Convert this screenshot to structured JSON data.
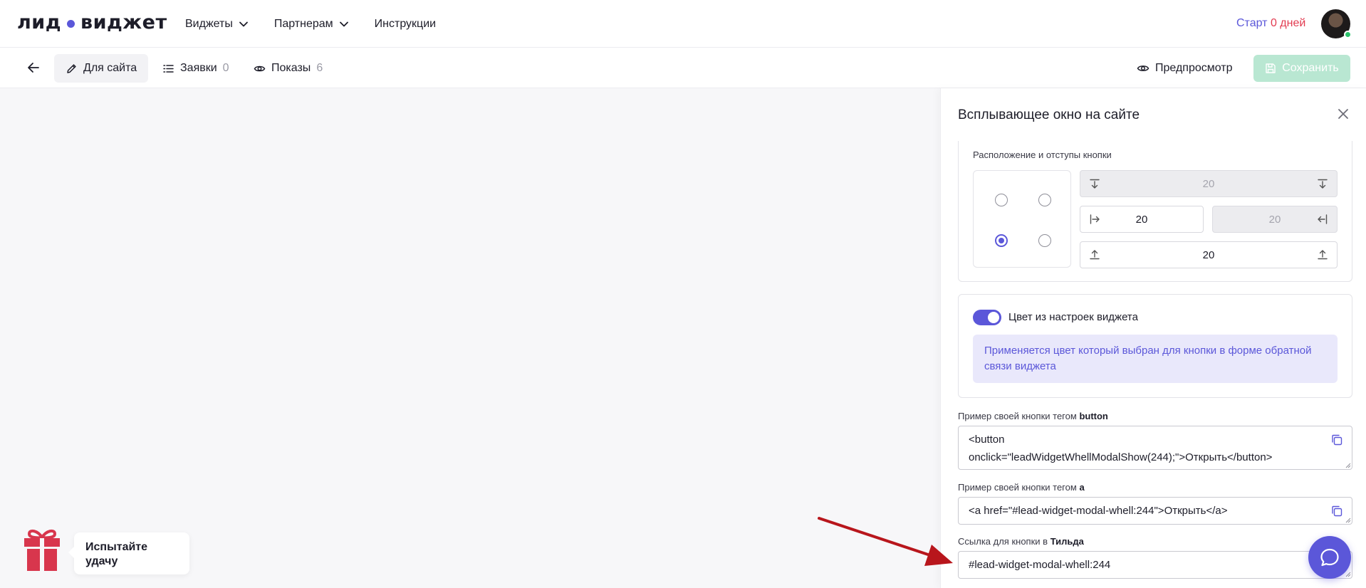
{
  "brand": {
    "logo_left": "лид",
    "logo_right": "виджет"
  },
  "nav": {
    "widgets": "Виджеты",
    "partners": "Партнерам",
    "instructions": "Инструкции"
  },
  "trial": {
    "label": "Старт",
    "days": "0 дней"
  },
  "toolbar": {
    "tab_site": "Для сайта",
    "tab_requests": "Заявки",
    "requests_count": "0",
    "tab_views": "Показы",
    "views_count": "6",
    "preview": "Предпросмотр",
    "save": "Сохранить"
  },
  "panel": {
    "title": "Всплывающее окно на сайте",
    "position_label": "Расположение и отступы кнопки",
    "selected_corner": "bottom-left",
    "offsets": {
      "top": "20",
      "left": "20",
      "right": "20",
      "bottom": "20"
    },
    "toggle_label": "Цвет из настроек виджета",
    "toggle_on": true,
    "info": "Применяется цвет который выбран для кнопки в форме обратной связи виджета",
    "button_example_label": "Пример своей кнопки тегом",
    "button_tag": "button",
    "button_code_line1": "<button",
    "button_code_line2": "onclick=\"leadWidgetWhellModalShow(244);\">Открыть</button>",
    "a_example_label": "Пример своей кнопки тегом",
    "a_tag": "a",
    "a_code": "<a href=\"#lead-widget-modal-whell:244\">Открыть</a>",
    "tilda_label": "Ссылка для кнопки в",
    "tilda_tag": "Тильда",
    "tilda_code": "#lead-widget-modal-whell:244"
  },
  "promo": {
    "line1": "Испытайте",
    "line2": "удачу"
  },
  "colors": {
    "accent": "#5b57d9",
    "danger": "#e23b50",
    "save_disabled": "#b9e7d2",
    "gift": "#d8364d",
    "arrow": "#b8161c"
  }
}
